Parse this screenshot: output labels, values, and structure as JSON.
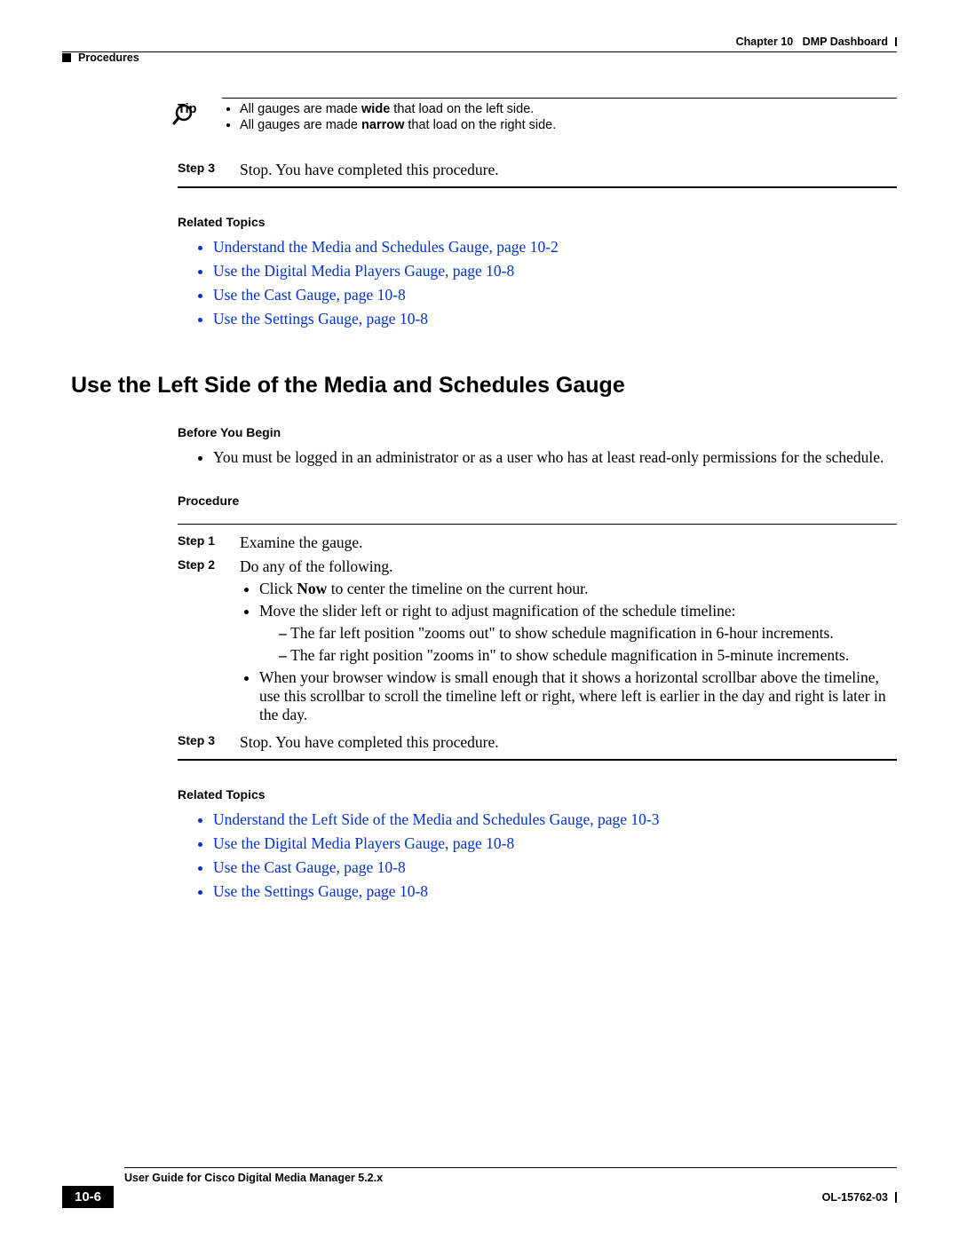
{
  "header": {
    "left_label": "Procedures",
    "right_chapter": "Chapter 10",
    "right_title": "DMP Dashboard"
  },
  "tip": {
    "label": "Tip",
    "bullets": [
      {
        "pre": "All gauges are made ",
        "bold": "wide",
        "post": " that load on the left side."
      },
      {
        "pre": "All gauges are made ",
        "bold": "narrow",
        "post": " that load on the right side."
      }
    ]
  },
  "step3a": {
    "label": "Step 3",
    "text": "Stop. You have completed this procedure."
  },
  "related1": {
    "heading": "Related Topics",
    "links": [
      "Understand the Media and Schedules Gauge, page 10-2",
      "Use the Digital Media Players Gauge, page 10-8",
      "Use the Cast Gauge, page 10-8",
      "Use the Settings Gauge, page 10-8"
    ]
  },
  "section_title": "Use the Left Side of the Media and Schedules Gauge",
  "byb": {
    "heading": "Before You Begin",
    "bullets": [
      "You must be logged in an administrator or as a user who has at least read-only permissions for the schedule."
    ]
  },
  "procedure": {
    "heading": "Procedure",
    "steps": {
      "s1": {
        "label": "Step 1",
        "text": "Examine the gauge."
      },
      "s2": {
        "label": "Step 2",
        "text": "Do any of the following.",
        "b1_pre": "Click ",
        "b1_bold": "Now",
        "b1_post": " to center the timeline on the current hour.",
        "b2": "Move the slider left or right to adjust magnification of the schedule timeline:",
        "b2d1": "The far left position \"zooms out\" to show schedule magnification in 6-hour increments.",
        "b2d2": "The far right position \"zooms in\" to show schedule magnification in 5-minute increments.",
        "b3": "When your browser window is small enough that it shows a horizontal scrollbar above the timeline, use this scrollbar to scroll the timeline left or right, where left is earlier in the day and right is later in the day."
      },
      "s3": {
        "label": "Step 3",
        "text": "Stop. You have completed this procedure."
      }
    }
  },
  "related2": {
    "heading": "Related Topics",
    "links": [
      "Understand the Left Side of the Media and Schedules Gauge, page 10-3",
      "Use the Digital Media Players Gauge, page 10-8",
      "Use the Cast Gauge, page 10-8",
      "Use the Settings Gauge, page 10-8"
    ]
  },
  "footer": {
    "guide_title": "User Guide for Cisco Digital Media Manager 5.2.x",
    "page_number": "10-6",
    "doc_id": "OL-15762-03"
  }
}
